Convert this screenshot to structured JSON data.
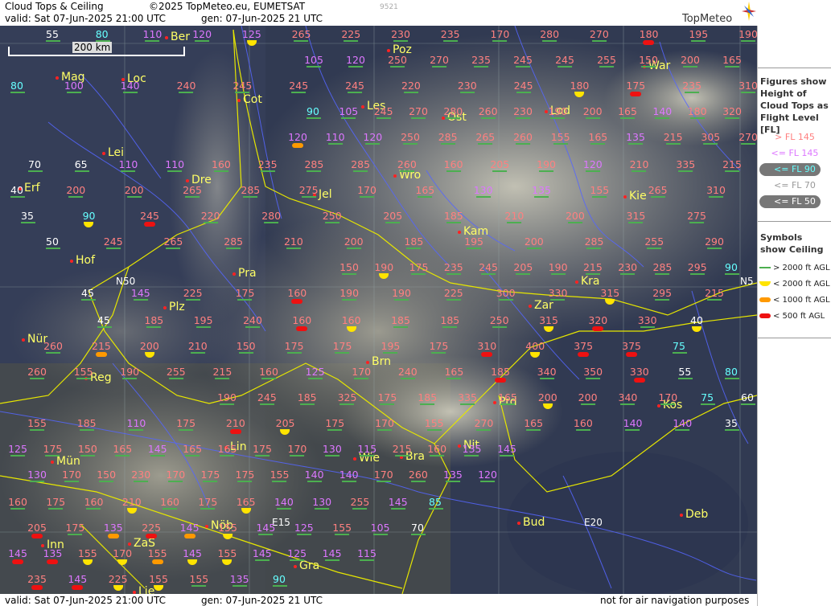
{
  "header": {
    "product": "Cloud Tops & Ceiling",
    "copyright": "©2025 TopMeteo.eu, EUMETSAT",
    "watermark": "9521",
    "valid": "valid:  Sat  07-Jun-2025  21:00 UTC",
    "gen": "gen: 07-Jun-2025 21 UTC",
    "logo": "TopMeteo"
  },
  "footer": {
    "valid": "valid:  Sat  07-Jun-2025  21:00 UTC",
    "gen": "gen: 07-Jun-2025 21 UTC",
    "note": "not for air navigation purposes"
  },
  "scale": {
    "label": "200 km"
  },
  "legend": {
    "figures_title": "Figures show Height of Cloud Tops as Flight Level  [FL]",
    "levels": [
      {
        "label": "> FL 145",
        "color": "#ff8080"
      },
      {
        "label": "<= FL 145",
        "color": "#dd77ff"
      },
      {
        "label": "<= FL 90",
        "color": "#66ffff"
      },
      {
        "label": "<= FL 70",
        "color": "#eeeeee"
      },
      {
        "label": "<= FL 50",
        "color": "#ffffff"
      }
    ],
    "symbols_title": "Symbols show Ceiling",
    "symbols": [
      {
        "label": "> 2000 ft AGL",
        "color": "#4caf50"
      },
      {
        "label": "< 2000 ft AGL",
        "color": "#ffe400"
      },
      {
        "label": "< 1000 ft AGL",
        "color": "#ff9900"
      },
      {
        "label": "< 500 ft AGL",
        "color": "#ee1111"
      }
    ]
  },
  "grid_labels": [
    "N50",
    "N5",
    "E15",
    "E20"
  ],
  "cities": [
    "Ber",
    "Poz",
    "War",
    "Mag",
    "Loc",
    "Cot",
    "Les",
    "Ost",
    "Lod",
    "Lei",
    "Dre",
    "Wro",
    "Jel",
    "Kie",
    "Erf",
    "Kam",
    "Hof",
    "Pra",
    "Kra",
    "Plz",
    "Zar",
    "Nür",
    "Brn",
    "Reg",
    "Kos",
    "Prd",
    "Lin",
    "Nit",
    "Mün",
    "Wie",
    "Bra",
    "Inn",
    "Nöb",
    "Bud",
    "Deb",
    "ZaS",
    "Gra",
    "Lie"
  ],
  "colors": {
    "high": "#ff8080",
    "mid": "#dd77ff",
    "low": "#66ffff",
    "vlow": "#ffffff",
    "city": "#ffff66",
    "border": "#e6e600",
    "river": "#5566ff"
  },
  "flight_levels": [
    [
      "55",
      "80",
      "110",
      "120",
      "125",
      "265",
      "225",
      "230",
      "235",
      "170",
      "280",
      "270",
      "180",
      "195",
      "190"
    ],
    [
      "105",
      "120",
      "250",
      "270",
      "235",
      "245",
      "245",
      "255",
      "150",
      "200",
      "165"
    ],
    [
      "80",
      "100",
      "140",
      "240",
      "245",
      "245",
      "245",
      "220",
      "230",
      "245",
      "180",
      "175",
      "235",
      "310"
    ],
    [
      "90",
      "105",
      "245",
      "270",
      "280",
      "260",
      "230",
      "190",
      "200",
      "165",
      "140",
      "180",
      "320"
    ],
    [
      "120",
      "110",
      "120",
      "250",
      "285",
      "265",
      "260",
      "155",
      "165",
      "135",
      "215",
      "305",
      "270"
    ],
    [
      "70",
      "65",
      "110",
      "110",
      "160",
      "235",
      "285",
      "285",
      "260",
      "160",
      "205",
      "190",
      "120",
      "210",
      "335",
      "215"
    ],
    [
      "40",
      "200",
      "200",
      "265",
      "285",
      "275",
      "170",
      "165",
      "130",
      "135",
      "155",
      "265",
      "310"
    ],
    [
      "35",
      "90",
      "245",
      "220",
      "280",
      "250",
      "205",
      "185",
      "210",
      "200",
      "315",
      "275"
    ],
    [
      "50",
      "245",
      "265",
      "285",
      "210",
      "200",
      "185",
      "195",
      "200",
      "285",
      "255",
      "290"
    ],
    [
      "150",
      "190",
      "175",
      "235",
      "245",
      "205",
      "190",
      "215",
      "230",
      "285",
      "295",
      "90"
    ],
    [
      "45",
      "145",
      "225",
      "175",
      "160",
      "190",
      "190",
      "225",
      "300",
      "330",
      "315",
      "295",
      "215"
    ],
    [
      "45",
      "185",
      "195",
      "240",
      "160",
      "160",
      "185",
      "185",
      "250",
      "315",
      "320",
      "330",
      "40"
    ],
    [
      "260",
      "215",
      "200",
      "210",
      "150",
      "175",
      "175",
      "195",
      "175",
      "310",
      "400",
      "375",
      "375",
      "75"
    ],
    [
      "260",
      "155",
      "190",
      "255",
      "215",
      "160",
      "125",
      "170",
      "240",
      "165",
      "185",
      "340",
      "350",
      "330",
      "55",
      "80"
    ],
    [
      "190",
      "245",
      "185",
      "325",
      "175",
      "185",
      "335",
      "165",
      "200",
      "200",
      "340",
      "170",
      "75",
      "60"
    ],
    [
      "155",
      "185",
      "110",
      "175",
      "210",
      "205",
      "175",
      "170",
      "155",
      "270",
      "165",
      "160",
      "140",
      "140",
      "35"
    ],
    [
      "125",
      "175",
      "150",
      "165",
      "145",
      "165",
      "165",
      "175",
      "170",
      "130",
      "115",
      "215",
      "160",
      "135",
      "145"
    ],
    [
      "130",
      "170",
      "150",
      "230",
      "170",
      "175",
      "175",
      "155",
      "140",
      "140",
      "170",
      "260",
      "135",
      "120"
    ],
    [
      "160",
      "175",
      "160",
      "210",
      "160",
      "175",
      "165",
      "140",
      "130",
      "255",
      "145",
      "85"
    ],
    [
      "205",
      "175",
      "135",
      "225",
      "145",
      "155",
      "145",
      "125",
      "155",
      "105",
      "70"
    ],
    [
      "145",
      "135",
      "155",
      "170",
      "155",
      "145",
      "155",
      "145",
      "125",
      "145",
      "115"
    ],
    [
      "235",
      "145",
      "225",
      "155",
      "155",
      "135",
      "90"
    ]
  ]
}
